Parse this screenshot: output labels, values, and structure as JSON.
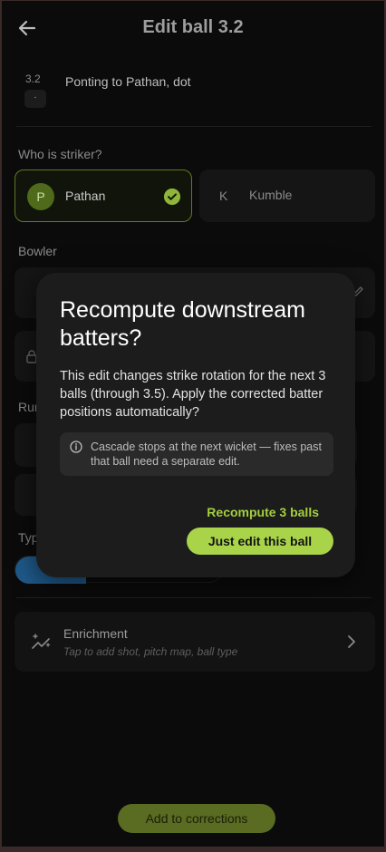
{
  "header": {
    "title": "Edit ball 3.2"
  },
  "ball": {
    "number": "3.2",
    "marker": "·",
    "description": "Ponting to Pathan, dot"
  },
  "striker": {
    "label": "Who is striker?",
    "options": [
      {
        "initial": "P",
        "name": "Pathan",
        "selected": true
      },
      {
        "initial": "K",
        "name": "Kumble",
        "selected": false
      }
    ]
  },
  "bowler": {
    "label": "Bowler"
  },
  "runs": {
    "label_partial": "Run"
  },
  "type": {
    "label_partial": "Typ"
  },
  "enrichment": {
    "title": "Enrichment",
    "subtitle": "Tap to add shot, pitch map, ball type"
  },
  "footer": {
    "add_label": "Add to corrections"
  },
  "modal": {
    "title": "Recompute downstream batters?",
    "body": "This edit changes strike rotation for the next 3 balls (through 3.5). Apply the corrected batter positions automatically?",
    "note": "Cascade stops at the next wicket — fixes past that ball need a separate edit.",
    "secondary_label": "Recompute 3 balls",
    "primary_label": "Just edit this ball"
  },
  "colors": {
    "accent": "#a9d44a",
    "accent_dim": "#5f7a22",
    "surface": "#1c1c1c",
    "background": "#0b0b0b"
  },
  "icons": [
    "back-arrow-icon",
    "check-circle-icon",
    "enrichment-sparkle-icon",
    "chevron-right-icon",
    "info-icon",
    "edit-pencil-icon",
    "lock-icon"
  ]
}
